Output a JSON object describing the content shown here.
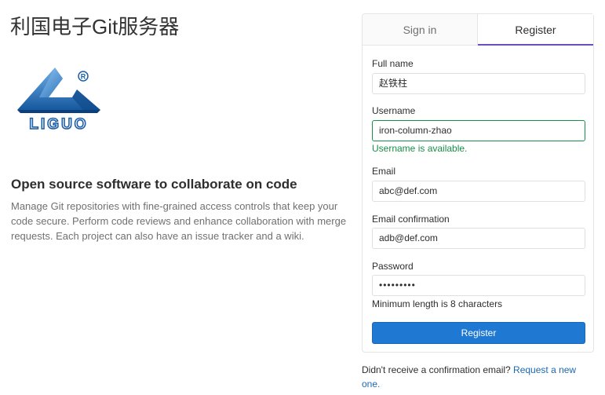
{
  "site": {
    "title": "利国电子Git服务器",
    "logo_text": "LIGUO",
    "logo_mark": "®"
  },
  "intro": {
    "tagline": "Open source software to collaborate on code",
    "description": "Manage Git repositories with fine-grained access controls that keep your code secure. Perform code reviews and enhance collaboration with merge requests. Each project can also have an issue tracker and a wiki."
  },
  "tabs": [
    {
      "label": "Sign in",
      "active": false
    },
    {
      "label": "Register",
      "active": true
    }
  ],
  "form": {
    "full_name": {
      "label": "Full name",
      "value": "赵铁柱"
    },
    "username": {
      "label": "Username",
      "value": "iron-column-zhao",
      "hint": "Username is available."
    },
    "email": {
      "label": "Email",
      "value": "abc@def.com"
    },
    "email_confirmation": {
      "label": "Email confirmation",
      "value": "adb@def.com"
    },
    "password": {
      "label": "Password",
      "value": "•••••••••",
      "hint": "Minimum length is 8 characters"
    },
    "submit_label": "Register"
  },
  "footer": {
    "confirmation_text": "Didn't receive a confirmation email? ",
    "confirmation_link": "Request a new one."
  },
  "colors": {
    "primary_button": "#1f78d1",
    "active_tab_underline": "#6b4fbb",
    "success": "#168f48",
    "link": "#1b69b6",
    "logo_blue": "#1d5fa8"
  }
}
